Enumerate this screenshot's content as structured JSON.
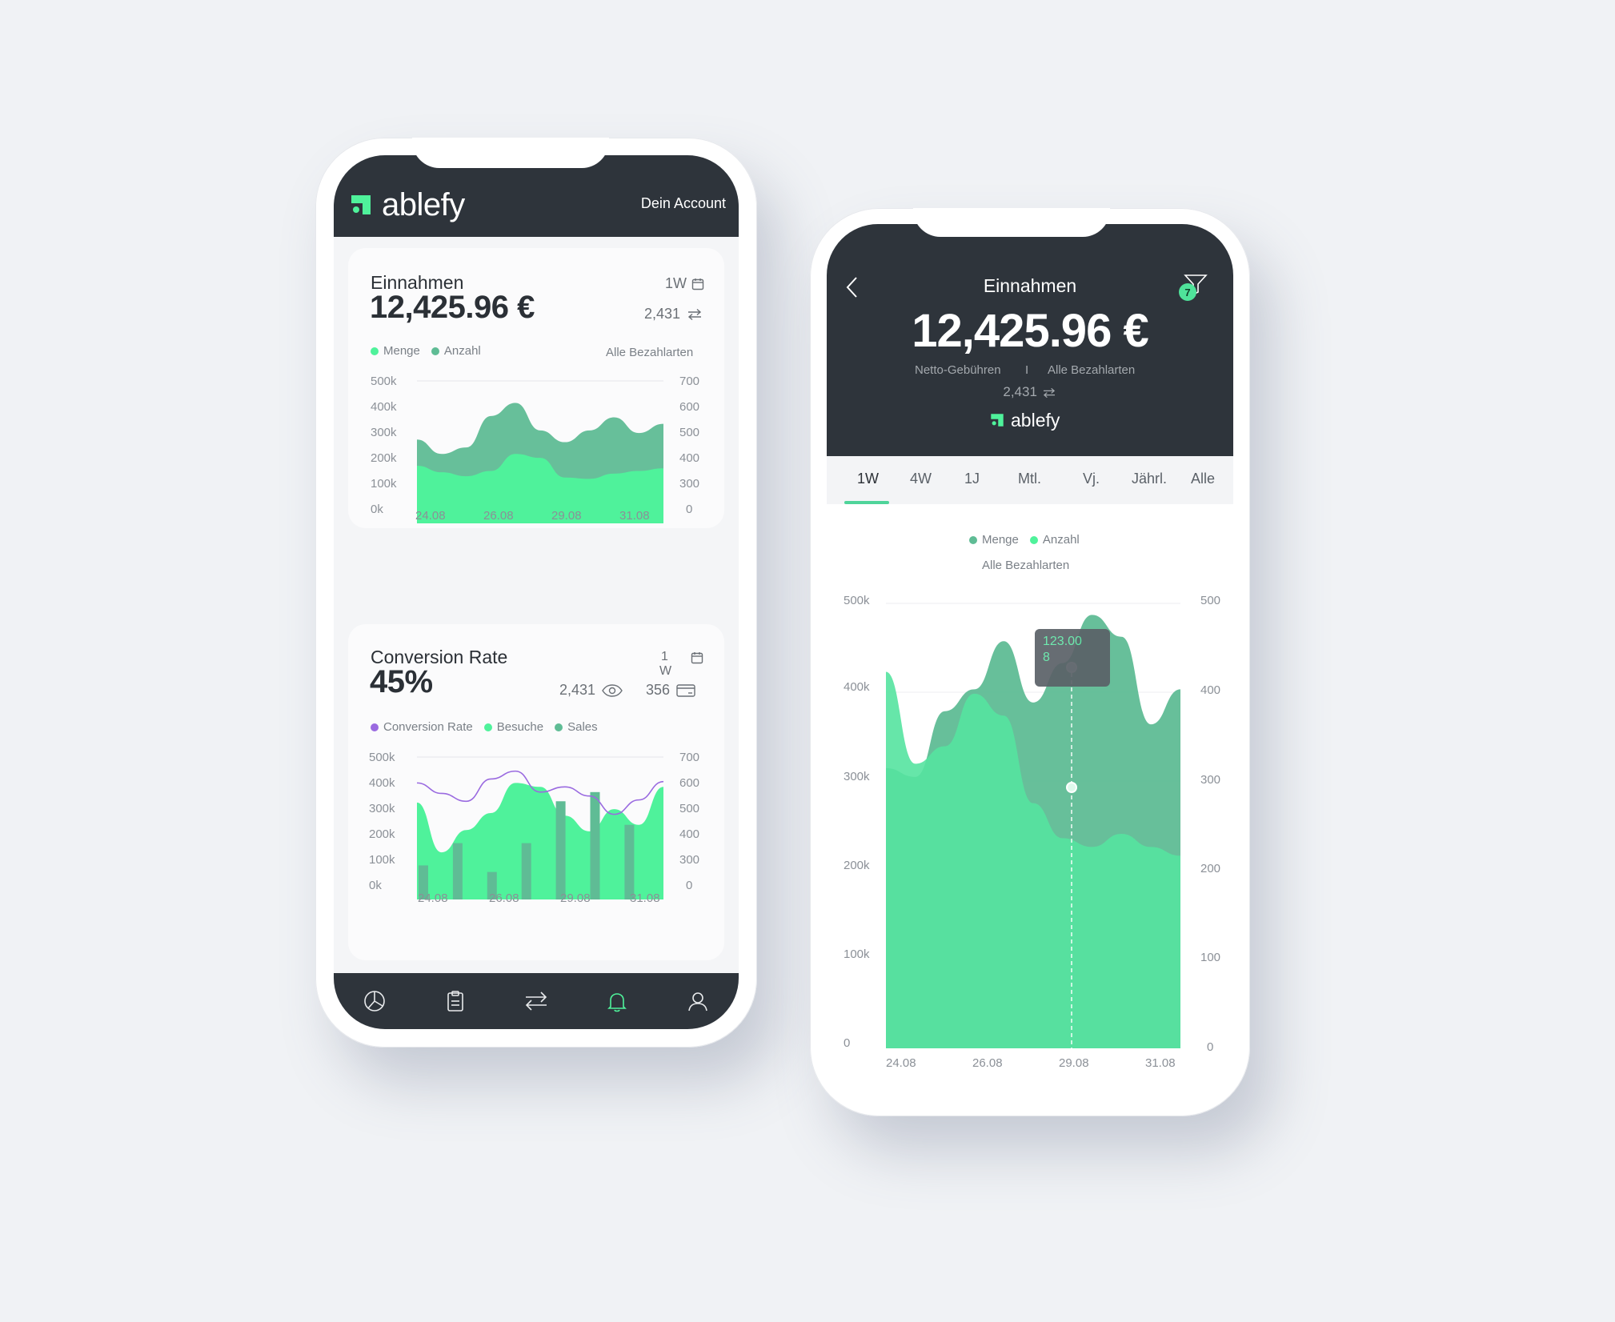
{
  "phone1": {
    "brand": "ablefy",
    "account_link": "Dein Account",
    "card1": {
      "title": "Einnahmen",
      "value": "12,425.96 €",
      "period": "1W",
      "count": "2,431",
      "legend": [
        "Menge",
        "Anzahl"
      ],
      "filter": "Alle Bezahlarten",
      "y_left_ticks": [
        "500k",
        "400k",
        "300k",
        "200k",
        "100k",
        "0k"
      ],
      "y_right_ticks": [
        "700",
        "600",
        "500",
        "400",
        "300",
        "0"
      ],
      "x_ticks": [
        "24.08",
        "26.08",
        "29.08",
        "31.08"
      ]
    },
    "card2": {
      "title": "Conversion Rate",
      "value": "45%",
      "period_top": "1",
      "period_bottom": "W",
      "views": "2,431",
      "payments": "356",
      "legend": [
        "Conversion Rate",
        "Besuche",
        "Sales"
      ],
      "y_left_ticks": [
        "500k",
        "400k",
        "300k",
        "200k",
        "100k",
        "0k"
      ],
      "y_right_ticks": [
        "700",
        "600",
        "500",
        "400",
        "300",
        "0"
      ],
      "x_ticks": [
        "24.08",
        "26.08",
        "29.08",
        "31.08"
      ]
    },
    "nav_icons": [
      "pie-chart-icon",
      "clipboard-icon",
      "transfer-icon",
      "bell-icon",
      "user-icon"
    ]
  },
  "phone2": {
    "title": "Einnahmen",
    "value": "12,425.96 €",
    "subtitle_left": "Netto-Gebühren",
    "subtitle_sep": "I",
    "subtitle_right": "Alle Bezahlarten",
    "count": "2,431",
    "brand": "ablefy",
    "filter_badge": "7",
    "tabs": [
      "1W",
      "4W",
      "1J",
      "Mtl.",
      "Vj.",
      "Jährl.",
      "Alle"
    ],
    "active_tab": "1W",
    "legend": [
      "Menge",
      "Anzahl"
    ],
    "filter": "Alle Bezahlarten",
    "tooltip_line1": "123.00",
    "tooltip_line2": "8",
    "y_left_ticks": [
      "500k",
      "400k",
      "300k",
      "200k",
      "100k",
      "0"
    ],
    "y_right_ticks": [
      "500",
      "400",
      "300",
      "200",
      "100",
      "0"
    ],
    "x_ticks": [
      "24.08",
      "26.08",
      "29.08",
      "31.08"
    ]
  },
  "colors": {
    "dark": "#2e343b",
    "green_light": "#4ff29b",
    "green_dark": "#5fbc95",
    "purple": "#9a6ae0"
  },
  "chart_data": [
    {
      "type": "area",
      "title": "Einnahmen",
      "categories": [
        "24.08",
        "26.08",
        "29.08",
        "31.08"
      ],
      "series": [
        {
          "name": "Menge",
          "axis": "left",
          "x": [
            0,
            0.1,
            0.2,
            0.3,
            0.4,
            0.5,
            0.6,
            0.7,
            0.8,
            0.9,
            1.0
          ],
          "values": [
            320,
            265,
            290,
            410,
            460,
            355,
            310,
            355,
            405,
            345,
            380
          ]
        },
        {
          "name": "Anzahl",
          "axis": "left",
          "x": [
            0,
            0.1,
            0.2,
            0.3,
            0.4,
            0.5,
            0.6,
            0.7,
            0.8,
            0.9,
            1.0
          ],
          "values": [
            220,
            195,
            180,
            200,
            265,
            250,
            175,
            170,
            190,
            200,
            210
          ]
        }
      ],
      "ylim_left": [
        0,
        500
      ],
      "ylim_right": [
        0,
        700
      ]
    },
    {
      "type": "bar",
      "title": "Conversion Rate",
      "categories": [
        "24.08",
        "26.08",
        "29.08",
        "31.08"
      ],
      "series": [
        {
          "name": "Besuche",
          "axis": "left",
          "x": [
            0,
            0.1,
            0.2,
            0.3,
            0.4,
            0.5,
            0.6,
            0.7,
            0.8,
            0.9,
            1.0
          ],
          "values": [
            370,
            180,
            265,
            330,
            445,
            430,
            320,
            260,
            345,
            285,
            430
          ]
        },
        {
          "name": "Sales",
          "axis": "left",
          "values": [
            130,
            215,
            105,
            215,
            375,
            410,
            285
          ]
        },
        {
          "name": "Conversion Rate",
          "axis": "left",
          "x": [
            0,
            0.1,
            0.2,
            0.3,
            0.4,
            0.5,
            0.6,
            0.7,
            0.8,
            0.9,
            1.0
          ],
          "values": [
            445,
            405,
            375,
            460,
            490,
            410,
            430,
            395,
            325,
            380,
            450
          ]
        }
      ],
      "ylim_left": [
        0,
        500
      ],
      "ylim_right": [
        0,
        700
      ]
    },
    {
      "type": "area",
      "title": "Einnahmen",
      "categories": [
        "24.08",
        "26.08",
        "29.08",
        "31.08"
      ],
      "series": [
        {
          "name": "Menge",
          "axis": "left",
          "x": [
            0,
            0.1,
            0.2,
            0.3,
            0.4,
            0.5,
            0.6,
            0.7,
            0.8,
            0.9,
            1.0
          ],
          "values": [
            320,
            310,
            385,
            410,
            465,
            395,
            440,
            495,
            470,
            370,
            410
          ]
        },
        {
          "name": "Anzahl",
          "axis": "left",
          "x": [
            0,
            0.1,
            0.2,
            0.3,
            0.4,
            0.5,
            0.6,
            0.7,
            0.8,
            0.9,
            1.0
          ],
          "values": [
            430,
            325,
            345,
            405,
            380,
            280,
            240,
            230,
            245,
            230,
            220
          ]
        }
      ],
      "highlight": {
        "x": "29.08",
        "value": "123.00",
        "count": "8"
      },
      "ylim_left": [
        0,
        500
      ],
      "ylim_right": [
        0,
        500
      ]
    }
  ]
}
